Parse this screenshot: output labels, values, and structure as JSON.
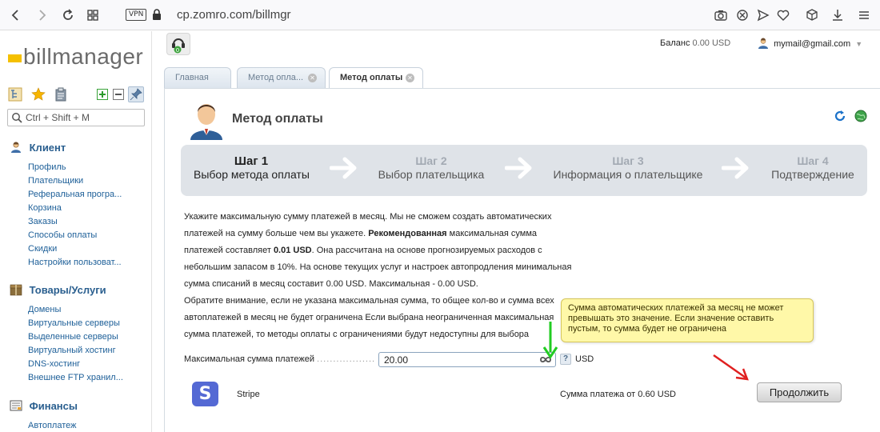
{
  "browser": {
    "vpn_label": "VPN",
    "url": "cp.zomro.com/billmgr"
  },
  "sidebar": {
    "logo_text": "billmanager",
    "search_placeholder": "Ctrl + Shift + M",
    "sections": [
      {
        "title": "Клиент",
        "items": [
          "Профиль",
          "Плательщики",
          "Реферальная програ...",
          "Корзина",
          "Заказы",
          "Способы оплаты",
          "Скидки",
          "Настройки пользоват..."
        ]
      },
      {
        "title": "Товары/Услуги",
        "items": [
          "Домены",
          "Виртуальные серверы",
          "Выделенные серверы",
          "Виртуальный хостинг",
          "DNS-хостинг",
          "Внешнее FTP хранил..."
        ]
      },
      {
        "title": "Финансы",
        "items": [
          "Автоплатеж"
        ]
      }
    ]
  },
  "header": {
    "support_badge": "0",
    "balance_label": "Баланс",
    "balance_value": "0.00 USD",
    "user_email": "mymail@gmail.com"
  },
  "tabs": [
    {
      "label": "Главная",
      "closable": false
    },
    {
      "label": "Метод опла...",
      "closable": true
    },
    {
      "label": "Метод оплаты",
      "closable": true,
      "active": true
    }
  ],
  "page": {
    "title": "Метод оплаты",
    "steps": [
      {
        "number": "Шаг 1",
        "title": "Выбор метода оплаты",
        "active": true
      },
      {
        "number": "Шаг 2",
        "title": "Выбор плательщика",
        "active": false
      },
      {
        "number": "Шаг 3",
        "title": "Информация о плательщике",
        "active": false
      },
      {
        "number": "Шаг 4",
        "title": "Подтверждение",
        "active": false
      }
    ],
    "description": {
      "p1": "Укажите максимальную сумму платежей в месяц. Мы не сможем создать автоматических платежей на сумму больше чем вы укажете. ",
      "p1_bold": "Рекомендованная",
      "p2": " максимальная сумма платежей составляет ",
      "p2_bold": "0.01 USD",
      "p3": ". Она рассчитана на основе прогнозируемых расходов с небольшим запасом в 10%. На основе текущих услуг и настроек автопродления минимальная сумма списаний в месяц составит 0.00 USD. Максимальная - 0.00 USD.",
      "p4": "Обратите внимание, если не указана максимальная сумма, то общее кол-во и сумма всех автоплатежей в месяц не будет ограничена Если выбрана неограниченная максимальная сумма платежей, то методы оплаты с ограничениями будут недоступны для выбора"
    },
    "tooltip": "Сумма автоматических платежей за месяц не может превышать это значение. Если значение оставить пустым, то сумма будет не ограничена",
    "field": {
      "label": "Максимальная сумма платежей",
      "value": "20.00",
      "help": "?",
      "currency": "USD"
    },
    "payment_method": {
      "logo_letter": "S",
      "name": "Stripe",
      "amount_text": "Сумма платежа от 0.60 USD"
    },
    "continue_label": "Продолжить"
  },
  "colors": {
    "link": "#1d5f98",
    "section_title": "#2a5f8f",
    "logo_bar": "#f5c000",
    "stripe": "#5469d4",
    "tooltip_bg": "#fff8a8",
    "annotation_green": "#22cc22",
    "annotation_red": "#e02020"
  }
}
